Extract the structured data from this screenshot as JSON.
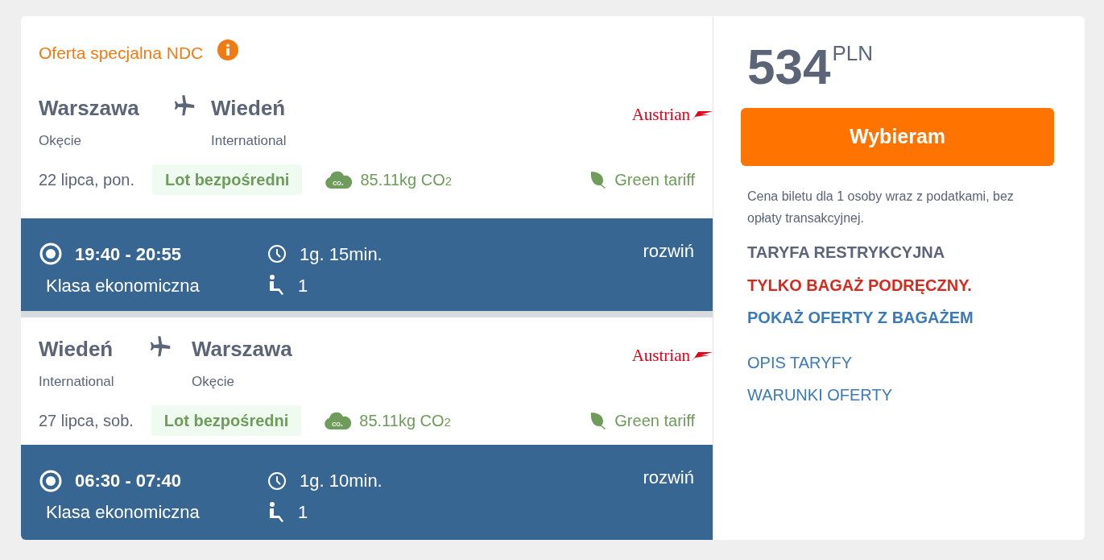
{
  "offer_label": "Oferta specjalna NDC",
  "legs": [
    {
      "from_city": "Warszawa",
      "from_airport": "Okęcie",
      "to_city": "Wiedeń",
      "to_airport": "International",
      "airline": "Austrian",
      "date": "22 lipca, pon.",
      "flight_type": "Lot bezpośredni",
      "emissions_icon": "CO₂",
      "emissions": "85.11kg CO$_{2}$",
      "tariff": "Green tariff",
      "times": "19:40 - 20:55",
      "duration": "1g. 15min.",
      "cabin": "Klasa ekonomiczna",
      "passengers": "1",
      "expand": "rozwiń",
      "selected": true
    },
    {
      "from_city": "Wiedeń",
      "from_airport": "International",
      "to_city": "Warszawa",
      "to_airport": "Okęcie",
      "airline": "Austrian",
      "date": "27 lipca, sob.",
      "flight_type": "Lot bezpośredni",
      "emissions_icon": "CO₂",
      "emissions": "85.11kg CO$_{2}$",
      "tariff": "Green tariff",
      "times": "06:30 - 07:40",
      "duration": "1g. 10min.",
      "cabin": "Klasa ekonomiczna",
      "passengers": "1",
      "expand": "rozwiń",
      "selected": true
    }
  ],
  "price": {
    "amount": "534",
    "currency": "PLN"
  },
  "select_button": "Wybieram",
  "price_note": "Cena biletu dla 1 osoby wraz z podatkami, bez opłaty transakcyjnej.",
  "fare_name": "TARYFA RESTRYKCYJNA",
  "baggage_warning": "TYLKO BAGAŻ PODRĘCZNY.",
  "baggage_link": "POKAŻ OFERTY Z BAGAŻEM",
  "links": [
    "OPIS TARYFY",
    "WARUNKI OFERTY"
  ]
}
